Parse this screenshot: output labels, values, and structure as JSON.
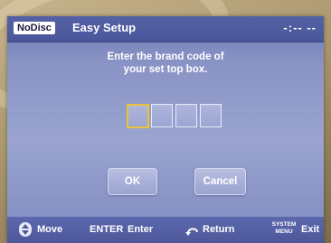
{
  "header": {
    "badge": "NoDisc",
    "title": "Easy Setup",
    "time": "-:-- --"
  },
  "prompt": {
    "line1": "Enter the brand code of",
    "line2": "your set top box."
  },
  "code_entry": {
    "digits": [
      "",
      "",
      "",
      ""
    ],
    "active_index": 0
  },
  "buttons": {
    "ok": "OK",
    "cancel": "Cancel"
  },
  "footer": {
    "move_label": "Move",
    "enter_key": "ENTER",
    "enter_label": "Enter",
    "return_label": "Return",
    "system_menu_key_line1": "SYSTEM",
    "system_menu_key_line2": "MENU",
    "exit_label": "Exit"
  },
  "colors": {
    "accent_highlight": "#e8c33c",
    "header_bg": "#4a5699",
    "screen_bg": "#9aa4cf"
  }
}
